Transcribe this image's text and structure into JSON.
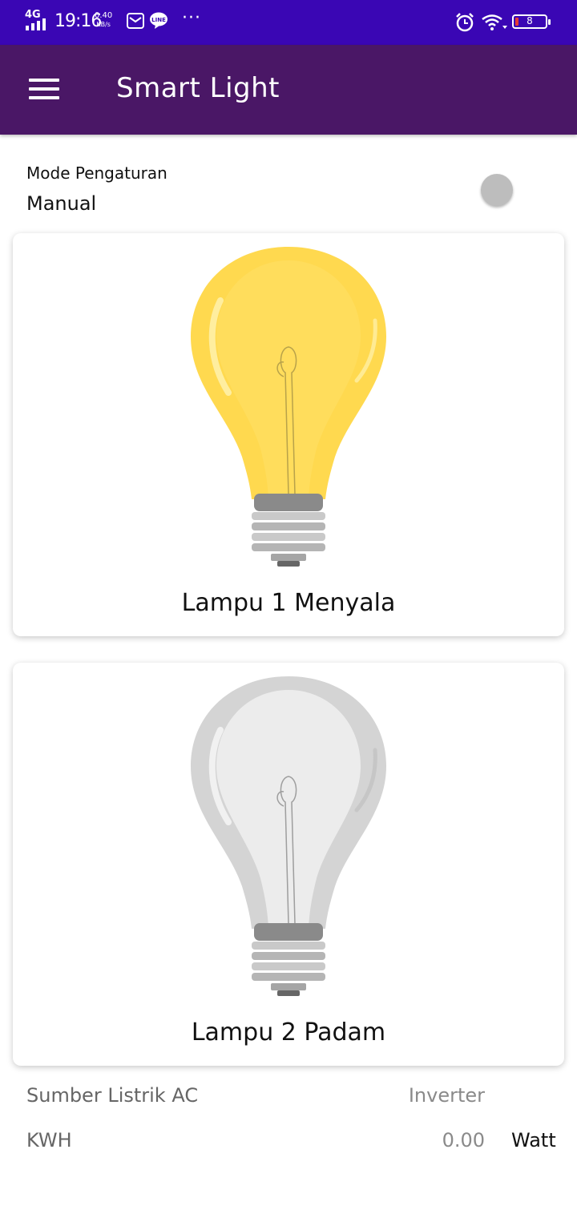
{
  "status_bar": {
    "network": "4G",
    "time": "19:16",
    "speed": "0.40",
    "speed_unit": "KB/s",
    "line_icon_text": "LINE",
    "more": "···",
    "battery_level": "8"
  },
  "app_bar": {
    "title": "Smart Light",
    "menu_icon": "hamburger-menu-icon",
    "background": "#4a1766"
  },
  "mode": {
    "label": "Mode Pengaturan",
    "value": "Manual",
    "toggle_on": false
  },
  "lamps": [
    {
      "label": "Lampu 1 Menyala",
      "state": "on",
      "color": "#ffd94f"
    },
    {
      "label": "Lampu 2 Padam",
      "state": "off",
      "color": "#d7d7d7"
    }
  ],
  "power": {
    "source_label": "Sumber Listrik AC",
    "source_value": "Inverter",
    "kwh_label": "KWH",
    "kwh_value": "0.00",
    "kwh_unit": "Watt"
  },
  "colors": {
    "status_bar": "#3a06b4",
    "app_bar": "#4a1766"
  }
}
